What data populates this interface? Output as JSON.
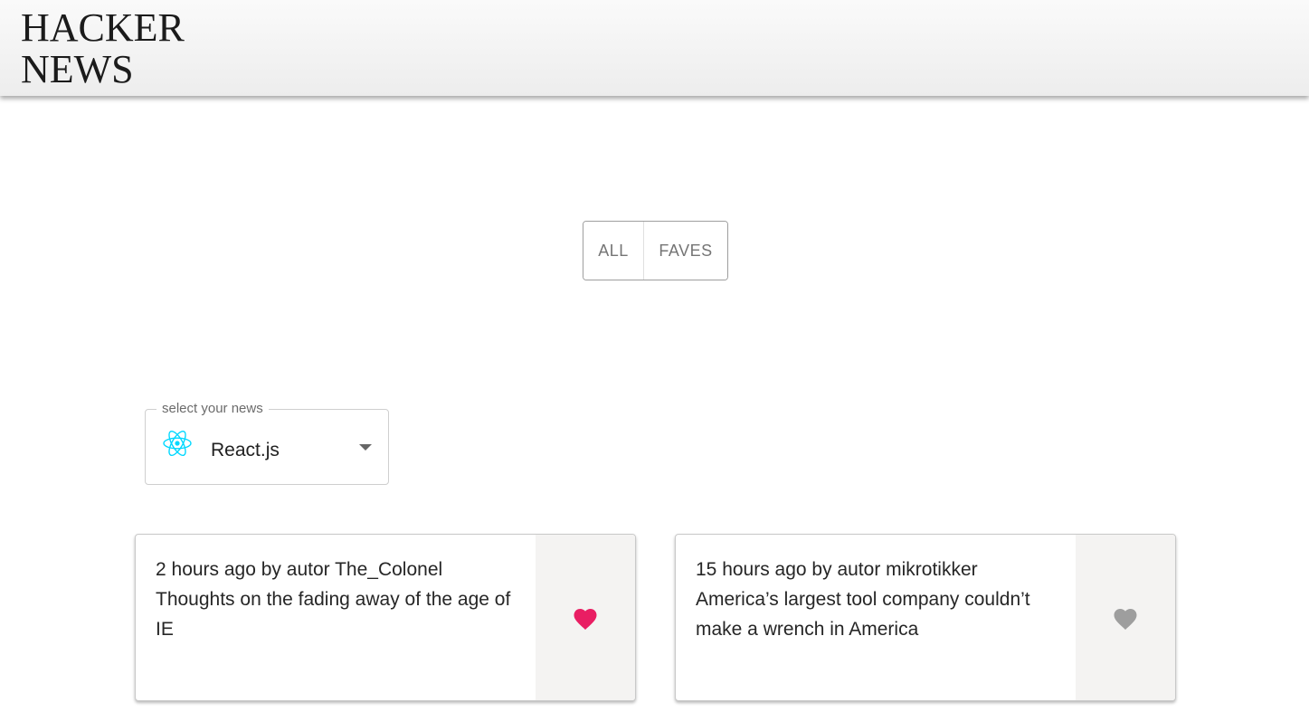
{
  "header": {
    "logo_line1": "HACKER",
    "logo_line2": "NEWS"
  },
  "filter": {
    "all_label": "ALL",
    "faves_label": "FAVES"
  },
  "news_select": {
    "label": "select your news",
    "selected_value": "React.js",
    "selected_icon": "react-icon"
  },
  "cards": [
    {
      "meta": "2 hours ago by autor The_Colonel",
      "title": "Thoughts on the fading away of the age of IE",
      "favorite": true,
      "heart_color": "#e91e63"
    },
    {
      "meta": "15 hours ago by autor mikrotikker",
      "title": "America’s largest tool company couldn’t make a wrench in America",
      "favorite": false,
      "heart_color": "#9e9e9e"
    }
  ],
  "colors": {
    "react_accent": "#00d8ff",
    "fave_active": "#e91e63",
    "fave_inactive": "#9e9e9e"
  }
}
